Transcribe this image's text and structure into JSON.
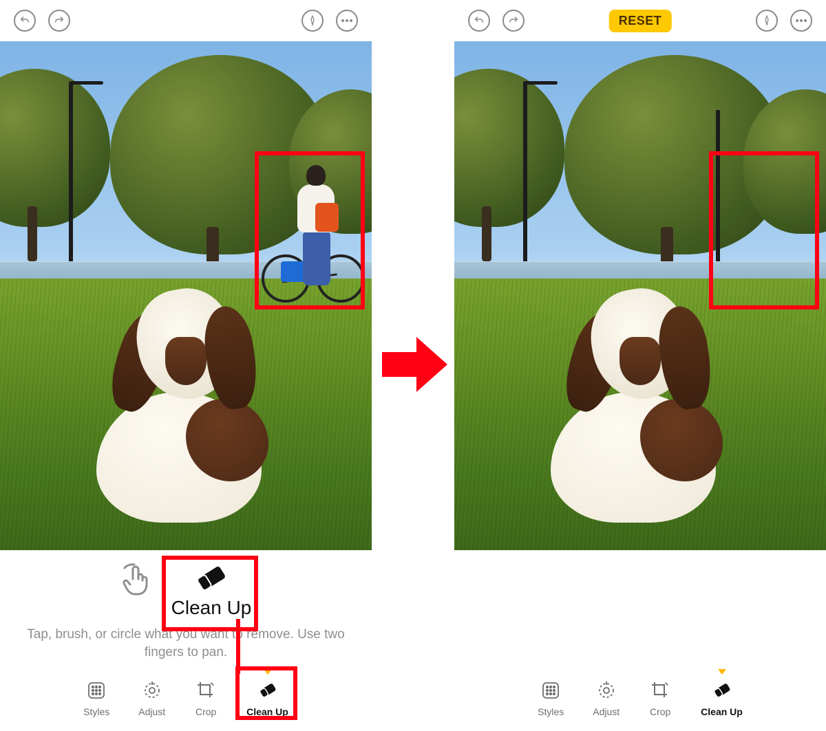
{
  "left": {
    "topbar": {
      "undo_tooltip": "Undo",
      "redo_tooltip": "Redo",
      "markup_tooltip": "Markup",
      "more_tooltip": "More"
    },
    "highlights": {
      "person_box": true,
      "cleanup_tile": true,
      "cleanup_tab": true
    },
    "cleanup": {
      "title": "Clean Up",
      "hint": "Tap, brush, or circle what you want to remove. Use two fingers to pan."
    },
    "tabs": {
      "styles": "Styles",
      "adjust": "Adjust",
      "crop": "Crop",
      "cleanup": "Clean Up",
      "active": "cleanup"
    }
  },
  "right": {
    "topbar": {
      "undo_tooltip": "Undo",
      "redo_tooltip": "Redo",
      "reset_label": "RESET",
      "markup_tooltip": "Markup",
      "more_tooltip": "More"
    },
    "highlights": {
      "person_box_after": true
    },
    "tabs": {
      "styles": "Styles",
      "adjust": "Adjust",
      "crop": "Crop",
      "cleanup": "Clean Up",
      "active": "cleanup"
    }
  }
}
